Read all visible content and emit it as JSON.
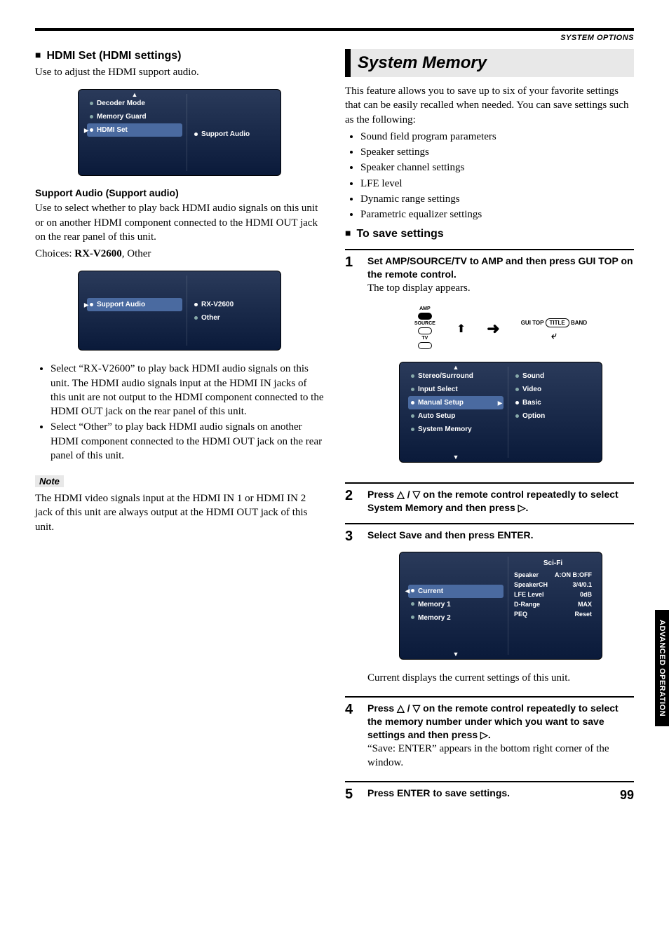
{
  "header": {
    "section_label": "SYSTEM OPTIONS"
  },
  "left": {
    "h1": "HDMI Set (HDMI settings)",
    "intro": "Use to adjust the HDMI support audio.",
    "osd1": {
      "left": [
        "Decoder Mode",
        "Memory Guard",
        "HDMI Set"
      ],
      "right": [
        "Support Audio"
      ]
    },
    "sub_h": "Support Audio (Support audio)",
    "sub_p": "Use to select whether to play back HDMI audio signals on this unit or on another HDMI component connected to the HDMI OUT jack on the rear panel of this unit.",
    "choices_label": "Choices: ",
    "choices_bold": "RX-V2600",
    "choices_rest": ", Other",
    "osd2": {
      "left": [
        "Support Audio"
      ],
      "right": [
        "RX-V2600",
        "Other"
      ]
    },
    "bullets": [
      "Select “RX-V2600” to play back HDMI audio signals on this unit. The HDMI audio signals input at the HDMI IN jacks of this unit are not output to the HDMI component connected to the HDMI OUT jack on the rear panel of this unit.",
      "Select “Other” to play back HDMI audio signals on another HDMI component connected to the HDMI OUT jack on the rear panel of this unit."
    ],
    "note_label": "Note",
    "note_text": "The HDMI video signals input at the HDMI IN 1 or HDMI IN 2 jack of this unit are always output at the HDMI OUT jack of this unit."
  },
  "right": {
    "title": "System Memory",
    "intro": "This feature allows you to save up to six of your favorite settings that can be easily recalled when needed. You can save settings such as the following:",
    "bullets": [
      "Sound field program parameters",
      "Speaker settings",
      "Speaker channel settings",
      "LFE level",
      "Dynamic range settings",
      "Parametric equalizer settings"
    ],
    "h2": "To save settings",
    "steps": {
      "s1": {
        "num": "1",
        "head": "Set AMP/SOURCE/TV to AMP and then press GUI TOP on the remote control.",
        "body": "The top display appears.",
        "remote": {
          "lbl_amp": "AMP",
          "lbl_src": "SOURCE",
          "lbl_tv": "TV",
          "gui_top": "GUI TOP",
          "title_btn": "TITLE",
          "band": "BAND"
        },
        "osd": {
          "left": [
            "Stereo/Surround",
            "Input Select",
            "Manual Setup",
            "Auto Setup",
            "System Memory"
          ],
          "right": [
            "Sound",
            "Video",
            "Basic",
            "Option"
          ]
        }
      },
      "s2": {
        "num": "2",
        "head_a": "Press ",
        "head_b": " / ",
        "head_c": " on the remote control repeatedly to select System Memory and then press ",
        "head_d": "."
      },
      "s3": {
        "num": "3",
        "head": "Select Save and then press ENTER.",
        "osd": {
          "left": [
            "Current",
            "Memory 1",
            "Memory 2"
          ],
          "right_title": "Sci-Fi",
          "kv": [
            [
              "Speaker",
              "A:ON B:OFF"
            ],
            [
              "SpeakerCH",
              "3/4/0.1"
            ],
            [
              "LFE Level",
              "0dB"
            ],
            [
              "D-Range",
              "MAX"
            ],
            [
              "PEQ",
              "Reset"
            ]
          ]
        },
        "caption": "Current displays the current settings of this unit."
      },
      "s4": {
        "num": "4",
        "head_a": "Press ",
        "head_b": " / ",
        "head_c": " on the remote control repeatedly to select the memory number under which you want to save settings and then press ",
        "head_d": ".",
        "body": "“Save: ENTER” appears in the bottom right corner of the window."
      },
      "s5": {
        "num": "5",
        "head": "Press ENTER to save settings."
      }
    }
  },
  "side_tab": "ADVANCED\nOPERATION",
  "page_num": "99"
}
